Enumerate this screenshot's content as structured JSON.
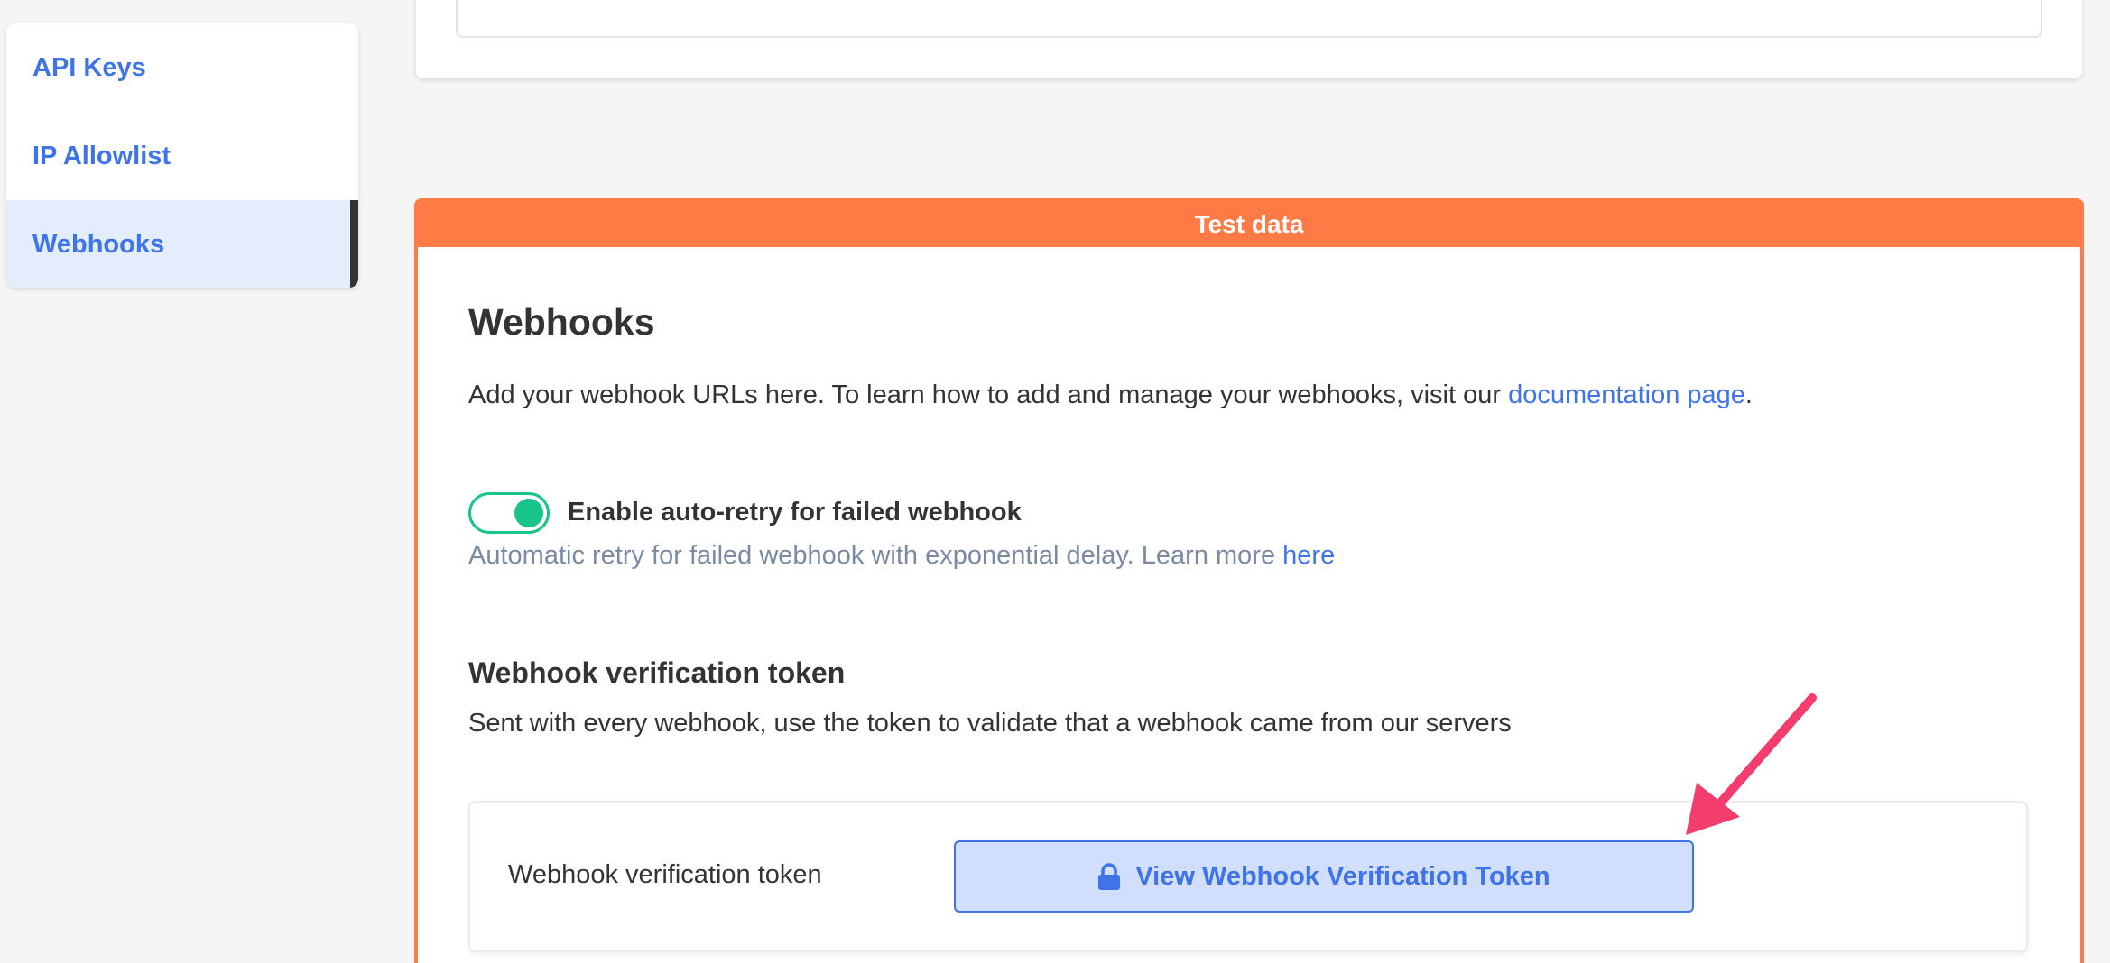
{
  "sidebar": {
    "items": [
      {
        "label": "API Keys"
      },
      {
        "label": "IP Allowlist"
      },
      {
        "label": "Webhooks"
      }
    ]
  },
  "banner": {
    "label": "Test data"
  },
  "webhooks": {
    "title": "Webhooks",
    "intro_prefix": "Add your webhook URLs here. To learn how to add and manage your webhooks, visit our ",
    "intro_link": "documentation page",
    "intro_suffix": ".",
    "auto_retry": {
      "label": "Enable auto-retry for failed webhook",
      "enabled": true,
      "description_prefix": "Automatic retry for failed webhook with exponential delay. Learn more ",
      "description_link": "here"
    },
    "verification": {
      "title": "Webhook verification token",
      "description": "Sent with every webhook, use the token to validate that a webhook came from our servers",
      "row_label": "Webhook verification token",
      "button_label": "View Webhook Verification Token"
    }
  },
  "colors": {
    "accent": "#3e74e8",
    "banner": "#ff7a45",
    "toggle": "#19c48a",
    "annotation_arrow": "#f23d6d"
  },
  "icons": {
    "lock": "lock-icon",
    "annotation": "annotation-arrow-icon"
  }
}
